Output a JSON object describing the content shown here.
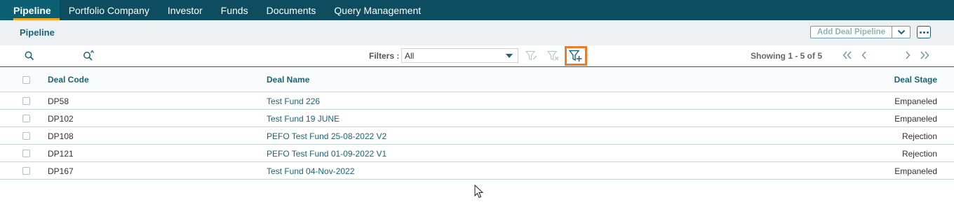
{
  "nav": {
    "tabs": [
      {
        "label": "Pipeline",
        "active": true
      },
      {
        "label": "Portfolio Company",
        "active": false
      },
      {
        "label": "Investor",
        "active": false
      },
      {
        "label": "Funds",
        "active": false
      },
      {
        "label": "Documents",
        "active": false
      },
      {
        "label": "Query Management",
        "active": false
      }
    ]
  },
  "header": {
    "title": "Pipeline",
    "add_button_label": "Add Deal Pipeline"
  },
  "toolbar": {
    "filters_label": "Filters :",
    "filter_value": "All",
    "showing_text": "Showing 1 - 5 of 5"
  },
  "table": {
    "columns": [
      "Deal Code",
      "Deal Name",
      "Deal Stage"
    ],
    "rows": [
      {
        "code": "DP58",
        "name": "Test Fund 226",
        "stage": "Empaneled"
      },
      {
        "code": "DP102",
        "name": "Test Fund 19 JUNE",
        "stage": "Empaneled"
      },
      {
        "code": "DP108",
        "name": "PEFO Test Fund 25-08-2022 V2",
        "stage": "Rejection"
      },
      {
        "code": "DP121",
        "name": "PEFO Test Fund 01-09-2022 V1",
        "stage": "Rejection"
      },
      {
        "code": "DP167",
        "name": "Test Fund 04-Nov-2022",
        "stage": "Empaneled"
      }
    ]
  },
  "colors": {
    "nav_bg": "#0e4c5f",
    "accent": "#1b6474",
    "active_underline": "#f5a623",
    "highlight": "#ee7b2c"
  }
}
